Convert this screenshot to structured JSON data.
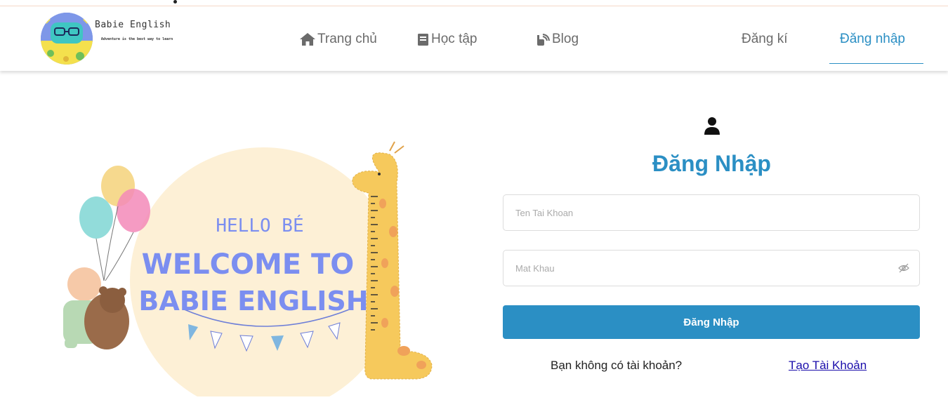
{
  "brand": {
    "name": "Babie English",
    "tagline": "Adventure is the best way to learn"
  },
  "nav": {
    "home": "Trang chủ",
    "learn": "Học tập",
    "blog": "Blog",
    "register": "Đăng kí",
    "login": "Đăng nhập"
  },
  "hero": {
    "greeting": "HELLO BÉ",
    "line1": "WELCOME TO",
    "line2": "BABIE ENGLISH"
  },
  "form": {
    "title": "Đăng Nhập",
    "username_placeholder": "Ten Tai Khoan",
    "password_placeholder": "Mat Khau",
    "submit_label": "Đăng Nhập",
    "no_account_text": "Bạn không có tài khoản?",
    "create_account_link": "Tạo Tài Khoản"
  },
  "colors": {
    "accent": "#2b8fc4",
    "nav_text": "#6b6b6b",
    "hero_circle": "#fdf0d6",
    "hero_text": "#7b8ef0"
  }
}
